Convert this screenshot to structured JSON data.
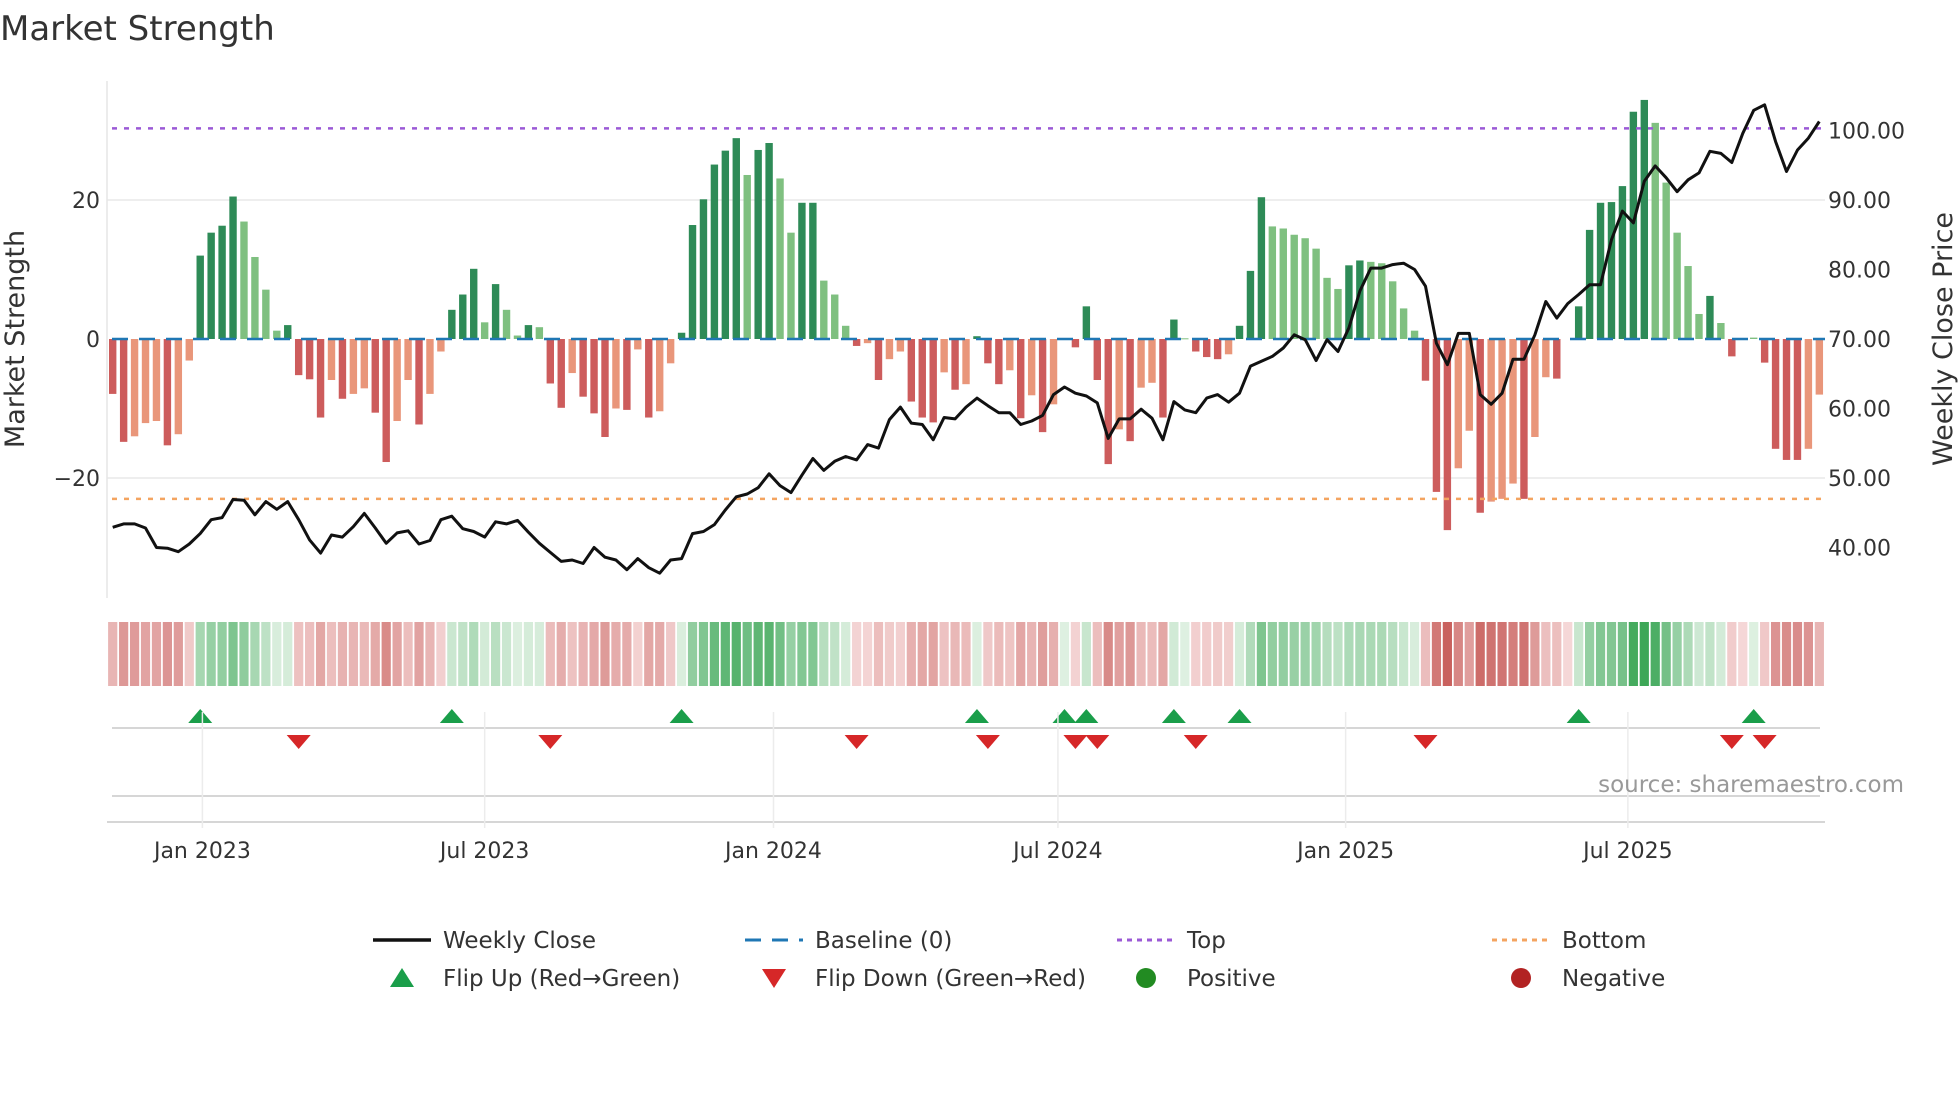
{
  "chart_data": {
    "type": "bar",
    "title": "Market Strength",
    "ylabel": "Market Strength",
    "y2label": "Weekly Close Price",
    "x_start": "2022-11-04",
    "x_frequency": "weekly",
    "ylim": [
      -35,
      40
    ],
    "y_ticks": [
      {
        "value": 20,
        "label": "20"
      },
      {
        "value": 0,
        "label": "0"
      },
      {
        "value": -20,
        "label": "−20"
      }
    ],
    "y2_ticks": [
      {
        "value": 100,
        "label": "100.00"
      },
      {
        "value": 90,
        "label": "90.00"
      },
      {
        "value": 80,
        "label": "80.00"
      },
      {
        "value": 70,
        "label": "70.00"
      },
      {
        "value": 60,
        "label": "60.00"
      },
      {
        "value": 50,
        "label": "50.00"
      },
      {
        "value": 40,
        "label": "40.00"
      }
    ],
    "x_ticks": [
      {
        "week_index": 8.2,
        "label": "Jan 2023"
      },
      {
        "week_index": 34.0,
        "label": "Jul 2023"
      },
      {
        "week_index": 60.4,
        "label": "Jan 2024"
      },
      {
        "week_index": 86.4,
        "label": "Jul 2024"
      },
      {
        "week_index": 112.7,
        "label": "Jan 2025"
      },
      {
        "week_index": 138.5,
        "label": "Jul 2025"
      }
    ],
    "top_threshold": 30.3,
    "bottom_threshold": -23,
    "baseline": 0,
    "strength": [
      -7.9,
      -14.8,
      -14,
      -12.1,
      -11.8,
      -15.3,
      -13.7,
      -3.1,
      12,
      15.3,
      16.3,
      20.5,
      16.9,
      11.8,
      7.1,
      1.2,
      2,
      -5.2,
      -5.8,
      -11.3,
      -5.9,
      -8.6,
      -7.9,
      -7.1,
      -10.6,
      -17.7,
      -11.8,
      -5.9,
      -12.3,
      -7.9,
      -1.8,
      4.2,
      6.4,
      10.1,
      2.4,
      7.9,
      4.2,
      0.5,
      2,
      1.7,
      -6.4,
      -9.9,
      -4.9,
      -8.3,
      -10.7,
      -14.1,
      -10,
      -10.2,
      -1.5,
      -11.3,
      -10.4,
      -3.5,
      0.9,
      16.4,
      20.1,
      25.1,
      27.1,
      28.9,
      23.6,
      27.2,
      28.2,
      23.1,
      15.3,
      19.6,
      19.6,
      8.4,
      6.4,
      1.9,
      -1,
      -0.6,
      -5.9,
      -2.9,
      -1.8,
      -9,
      -11.3,
      -12,
      -4.8,
      -7.3,
      -6.5,
      0.4,
      -3.5,
      -6.5,
      -4.5,
      -11.4,
      -8.1,
      -13.4,
      -9.4,
      0.1,
      -1.2,
      4.7,
      -5.9,
      -18,
      -13,
      -14.7,
      -7,
      -6.3,
      -11.3,
      2.8,
      0.1,
      -1.8,
      -2.6,
      -2.9,
      -2.2,
      1.9,
      9.8,
      20.4,
      16.2,
      15.9,
      15,
      14.5,
      13,
      8.8,
      7.2,
      10.6,
      11.3,
      11.1,
      10.9,
      8.3,
      4.4,
      1.2,
      -6,
      -22,
      -27.5,
      -18.6,
      -13.2,
      -25,
      -23.4,
      -23,
      -20.8,
      -23,
      -14.1,
      -5.5,
      -5.7,
      0,
      4.7,
      15.7,
      19.6,
      19.7,
      22,
      32.7,
      34.4,
      31.1,
      22.5,
      15.3,
      10.5,
      3.6,
      6.2,
      2.3,
      -2.5,
      0,
      0.2,
      -3.4,
      -15.8,
      -17.4,
      -17.4,
      -15.8,
      -8
    ],
    "strength_strong": [
      1,
      1,
      0,
      0,
      0,
      1,
      0,
      0,
      1,
      1,
      1,
      1,
      0,
      0,
      0,
      0,
      1,
      1,
      1,
      1,
      0,
      1,
      0,
      0,
      1,
      1,
      0,
      0,
      1,
      0,
      0,
      1,
      1,
      1,
      0,
      1,
      0,
      0,
      1,
      0,
      1,
      1,
      0,
      1,
      1,
      1,
      0,
      1,
      0,
      1,
      0,
      0,
      1,
      1,
      1,
      1,
      1,
      1,
      0,
      1,
      1,
      0,
      0,
      1,
      1,
      0,
      0,
      0,
      1,
      0,
      1,
      0,
      0,
      1,
      1,
      1,
      0,
      1,
      0,
      1,
      1,
      1,
      0,
      1,
      0,
      1,
      0,
      0,
      1,
      1,
      1,
      1,
      0,
      1,
      0,
      0,
      1,
      1,
      0,
      1,
      1,
      1,
      0,
      1,
      1,
      1,
      0,
      0,
      0,
      0,
      0,
      0,
      0,
      1,
      1,
      0,
      0,
      0,
      0,
      0,
      1,
      1,
      1,
      0,
      0,
      1,
      0,
      0,
      0,
      1,
      0,
      0,
      1,
      0,
      1,
      1,
      1,
      1,
      1,
      1,
      1,
      0,
      0,
      0,
      0,
      0,
      1,
      0,
      1,
      0,
      0,
      1,
      1,
      1,
      1,
      0,
      0
    ],
    "weekly_close": [
      42.9,
      43.4,
      43.4,
      42.8,
      40.0,
      39.9,
      39.4,
      40.5,
      42.0,
      44.0,
      44.3,
      46.9,
      46.8,
      44.7,
      46.6,
      45.5,
      46.6,
      44.0,
      41.1,
      39.2,
      41.8,
      41.5,
      43.0,
      44.9,
      42.8,
      40.6,
      42.1,
      42.4,
      40.5,
      41.0,
      44.0,
      44.5,
      42.7,
      42.3,
      41.5,
      43.7,
      43.4,
      43.9,
      42.2,
      40.6,
      39.3,
      38.0,
      38.2,
      37.7,
      40.0,
      38.6,
      38.2,
      36.8,
      38.4,
      37.1,
      36.3,
      38.2,
      38.4,
      42.0,
      42.3,
      43.3,
      45.4,
      47.3,
      47.7,
      48.6,
      50.6,
      48.9,
      47.9,
      50.4,
      52.8,
      51.1,
      52.4,
      53.1,
      52.6,
      54.8,
      54.3,
      58.4,
      60.2,
      57.9,
      57.7,
      55.5,
      58.7,
      58.5,
      60.2,
      61.5,
      60.4,
      59.4,
      59.4,
      57.7,
      58.2,
      59.0,
      62.0,
      63.1,
      62.2,
      61.8,
      60.8,
      55.7,
      58.5,
      58.5,
      59.9,
      58.6,
      55.5,
      61.0,
      59.8,
      59.4,
      61.5,
      62.0,
      60.9,
      62.2,
      66.1,
      66.8,
      67.5,
      68.7,
      70.6,
      69.9,
      66.9,
      69.9,
      68.2,
      71.6,
      76.9,
      80.2,
      80.2,
      80.7,
      80.9,
      80.0,
      77.6,
      69.4,
      66.3,
      70.8,
      70.8,
      62.0,
      60.6,
      62.2,
      67.1,
      67.1,
      70.6,
      75.4,
      73.0,
      75.1,
      76.4,
      77.8,
      77.8,
      84.3,
      88.4,
      86.7,
      92.7,
      94.9,
      93.2,
      91.2,
      92.9,
      93.9,
      97.0,
      96.7,
      95.4,
      99.6,
      102.9,
      103.7,
      98.4,
      94.1,
      97.2,
      98.9,
      101.3
    ],
    "flip_up_weeks": [
      8,
      31,
      52,
      79,
      87,
      89,
      97,
      103,
      134,
      150
    ],
    "flip_down_weeks": [
      17,
      40,
      68,
      80,
      88,
      90,
      99,
      120,
      148,
      151
    ],
    "legend": {
      "placement": "bottom",
      "items": [
        {
          "key": "close",
          "label": "Weekly Close"
        },
        {
          "key": "baseline",
          "label": "Baseline (0)"
        },
        {
          "key": "top",
          "label": "Top"
        },
        {
          "key": "bottom",
          "label": "Bottom"
        },
        {
          "key": "flip_up",
          "label": "Flip Up (Red→Green)"
        },
        {
          "key": "flip_down",
          "label": "Flip Down (Green→Red)"
        },
        {
          "key": "positive",
          "label": "Positive"
        },
        {
          "key": "negative",
          "label": "Negative"
        }
      ]
    },
    "source": "source: sharemaestro.com",
    "colors": {
      "strong_pos": "#2e8b57",
      "weak_pos": "#7fc080",
      "strong_neg": "#cd5c5c",
      "weak_neg": "#e9967a",
      "baseline": "#1f77b4",
      "top": "#9b59d6",
      "bottom": "#f4a460",
      "close": "#111111",
      "flip_up": "#1a9e4a",
      "flip_down": "#d62728",
      "positive": "#228b22",
      "negative": "#b22222"
    }
  }
}
